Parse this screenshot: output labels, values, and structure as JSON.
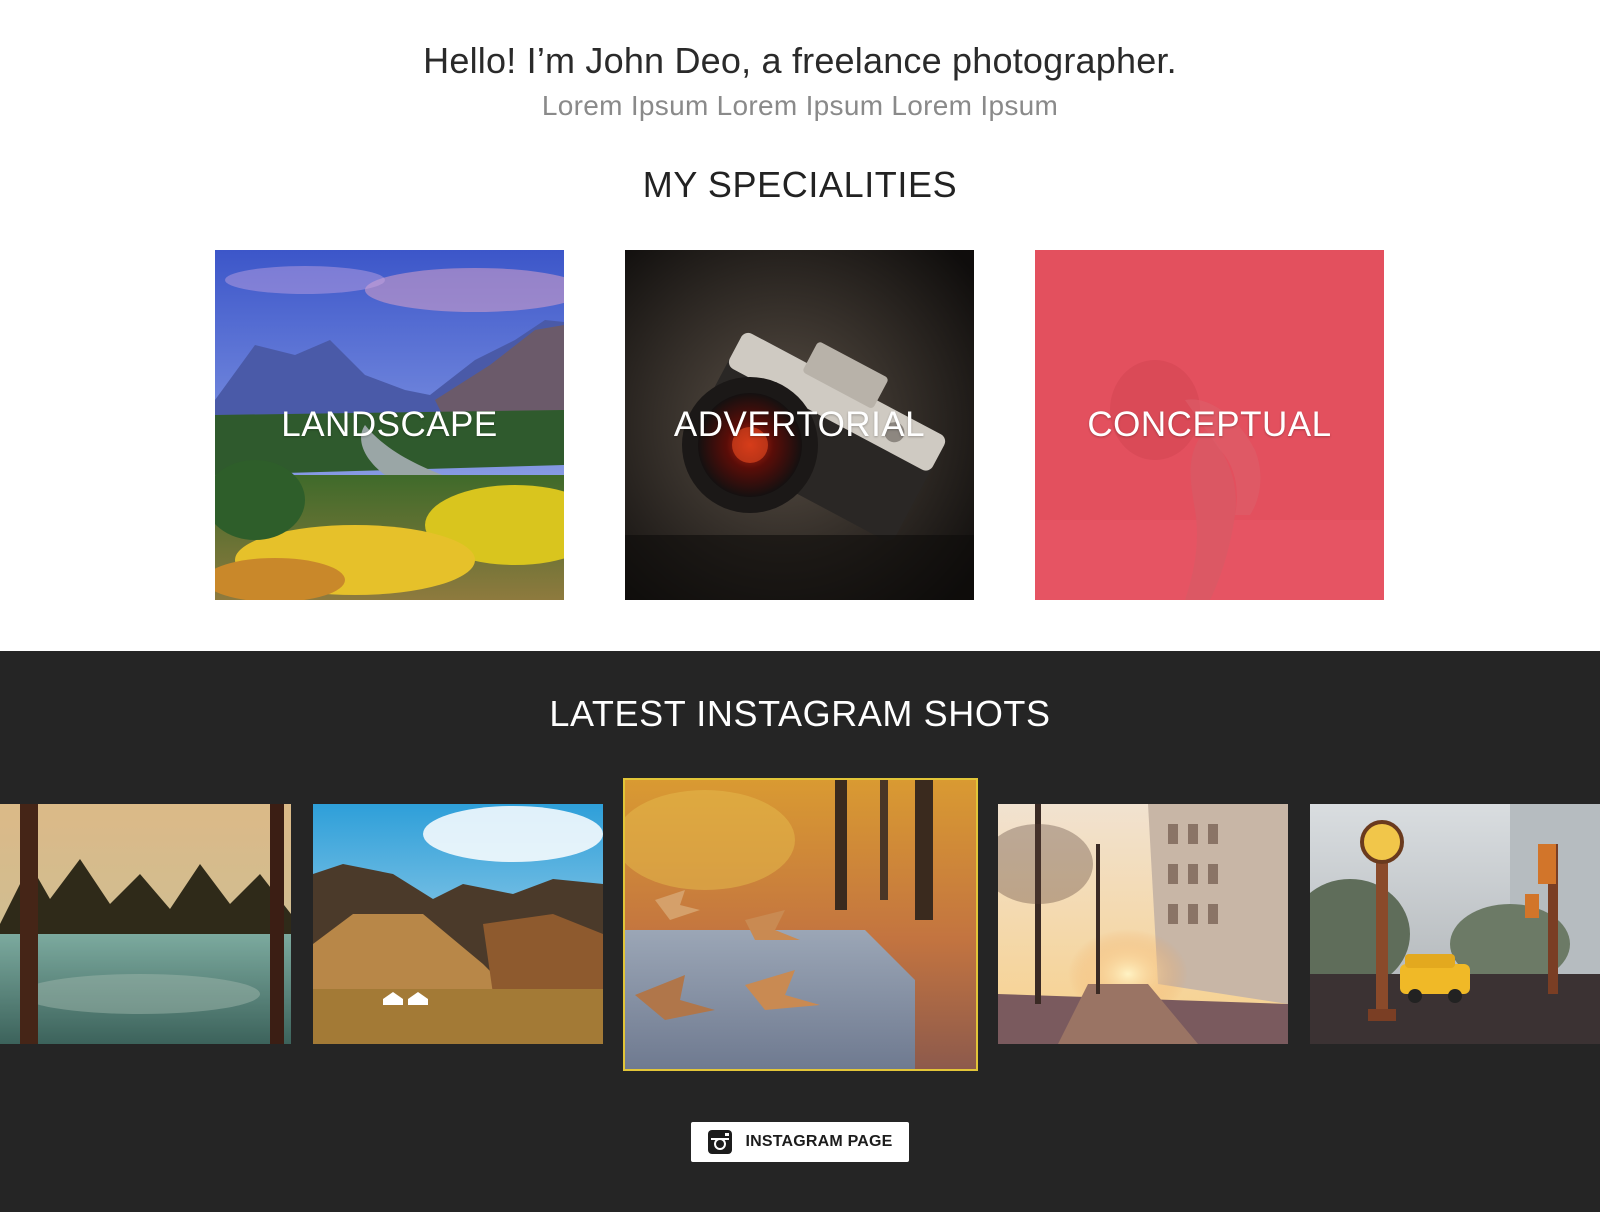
{
  "intro": {
    "title": "Hello! I’m John Deo, a freelance photographer.",
    "subtitle": "Lorem Ipsum Lorem Ipsum Lorem Ipsum"
  },
  "specialities": {
    "heading": "MY SPECIALITIES",
    "items": [
      {
        "label": "LANDSCAPE"
      },
      {
        "label": "ADVERTORIAL"
      },
      {
        "label": "CONCEPTUAL",
        "overlay_color": "#e8505f"
      }
    ]
  },
  "instagram": {
    "heading": "LATEST INSTAGRAM SHOTS",
    "active_index": 2,
    "active_border_color": "#e2c538",
    "button_label": "INSTAGRAM PAGE",
    "button_icon": "instagram-icon"
  },
  "colors": {
    "dark_bg": "#252525",
    "accent_pink": "#e8505f"
  }
}
